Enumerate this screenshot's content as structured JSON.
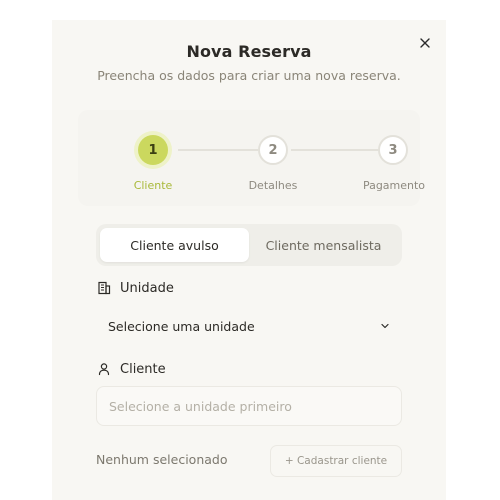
{
  "modal": {
    "title": "Nova Reserva",
    "subtitle": "Preencha os dados para criar uma nova reserva.",
    "close_icon": "close-icon"
  },
  "stepper": {
    "steps": [
      {
        "number": "1",
        "label": "Cliente",
        "active": true
      },
      {
        "number": "2",
        "label": "Detalhes",
        "active": false
      },
      {
        "number": "3",
        "label": "Pagamento",
        "active": false
      }
    ],
    "active_color": "#cbd85e"
  },
  "client_type": {
    "options": [
      "Cliente avulso",
      "Cliente mensalista"
    ],
    "selected": "Cliente avulso"
  },
  "unidade": {
    "label": "Unidade",
    "icon": "building-icon",
    "value": "Selecione uma unidade",
    "chevron_icon": "chevron-down-icon"
  },
  "cliente": {
    "label": "Cliente",
    "icon": "user-icon",
    "placeholder": "Selecione a unidade primeiro",
    "value": ""
  },
  "footer": {
    "status": "Nenhum selecionado",
    "add_button": "+ Cadastrar cliente"
  }
}
